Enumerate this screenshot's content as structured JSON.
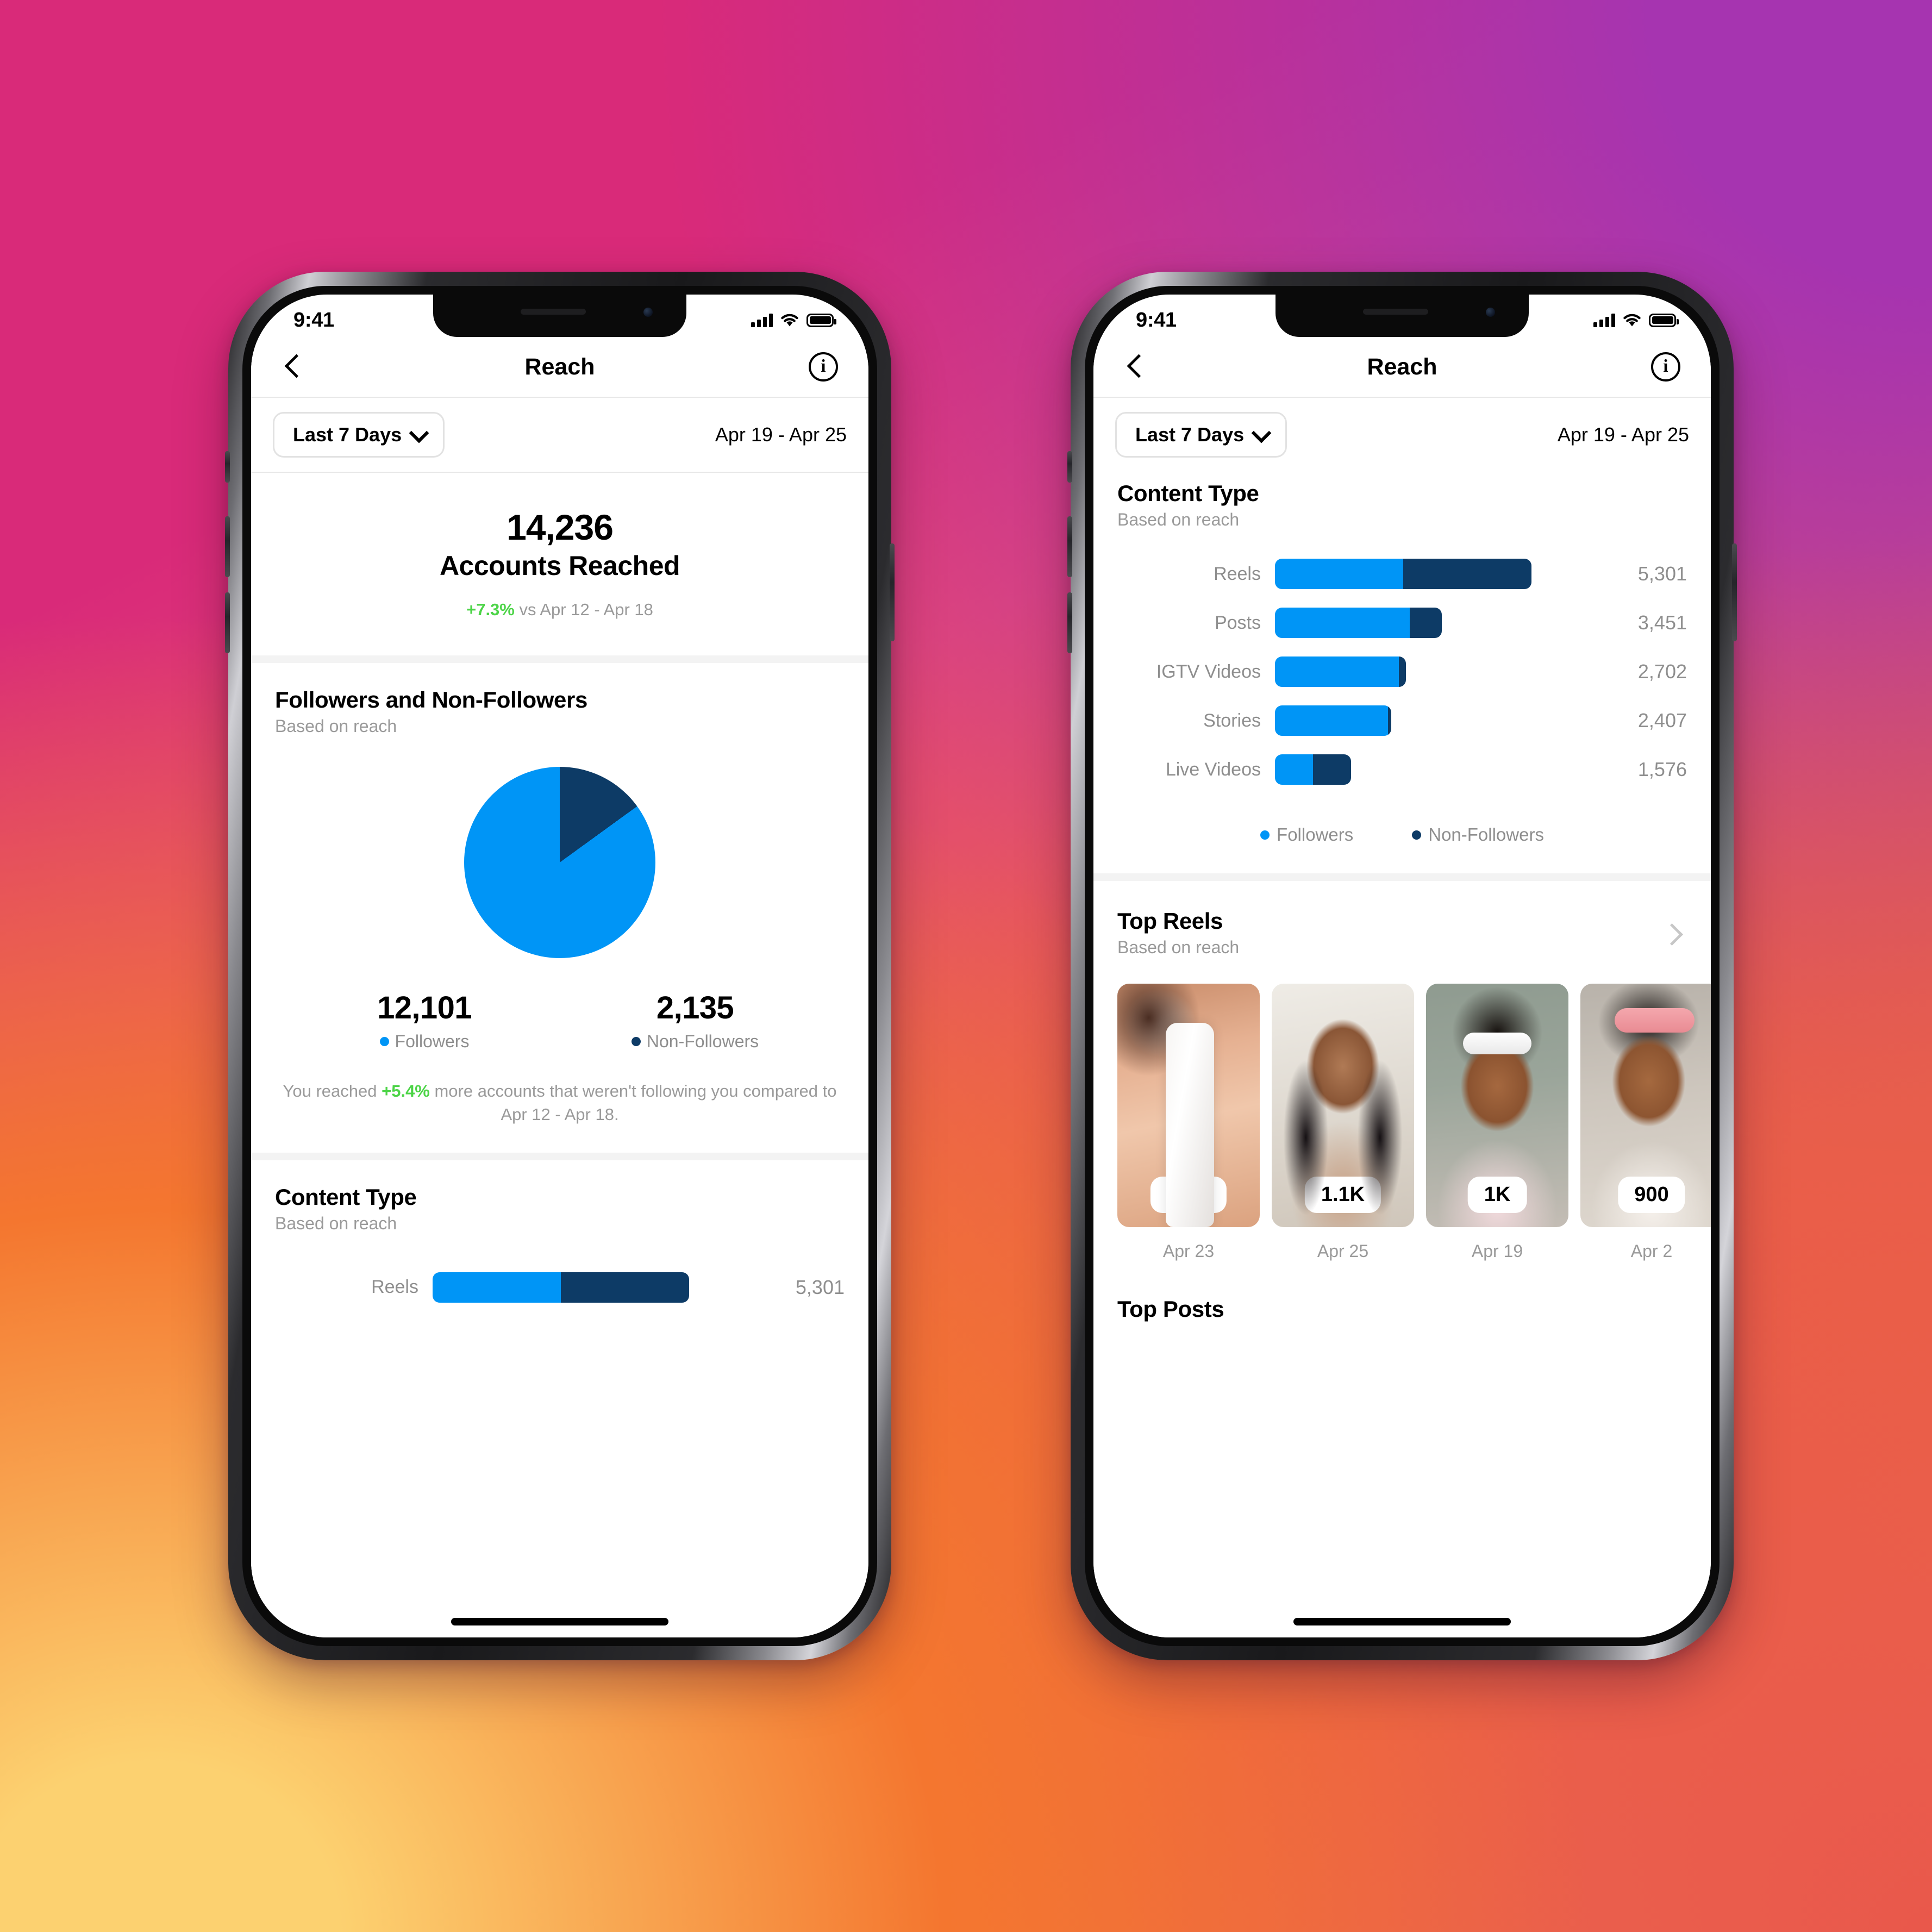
{
  "status_bar": {
    "time": "9:41",
    "icons": [
      "cellular-signal-icon",
      "wifi-icon",
      "battery-icon"
    ]
  },
  "nav": {
    "back_label": "Back",
    "title": "Reach",
    "info_label": "Info"
  },
  "filter": {
    "range_label": "Last 7 Days",
    "chevron": "chevron-down-icon",
    "date_range": "Apr 19 - Apr 25"
  },
  "hero": {
    "value": "14,236",
    "label": "Accounts Reached",
    "delta": "+7.3%",
    "delta_suffix": " vs Apr 12 - Apr 18"
  },
  "followers_section": {
    "title": "Followers and Non-Followers",
    "subtitle": "Based on reach",
    "followers_value": "12,101",
    "followers_label": "Followers",
    "nonfollowers_value": "2,135",
    "nonfollowers_label": "Non-Followers",
    "note_prefix": "You reached ",
    "note_delta": "+5.4%",
    "note_suffix": " more accounts that weren't following you compared to Apr 12 - Apr 18."
  },
  "content_type": {
    "title": "Content Type",
    "subtitle": "Based on reach",
    "legend": [
      {
        "label": "Followers",
        "color": "#0095F6"
      },
      {
        "label": "Non-Followers",
        "color": "#0D3B66"
      }
    ]
  },
  "top_reels": {
    "title": "Top Reels",
    "subtitle": "Based on reach",
    "chevron": "chevron-right-icon",
    "items": [
      {
        "badge": "2.3K",
        "date": "Apr 23",
        "alt": "reel-thumbnail-cleanser-bottle"
      },
      {
        "badge": "1.1K",
        "date": "Apr 25",
        "alt": "reel-thumbnail-portrait-long-hair"
      },
      {
        "badge": "1K",
        "date": "Apr 19",
        "alt": "reel-thumbnail-white-headband"
      },
      {
        "badge": "900",
        "date": "Apr 2",
        "alt": "reel-thumbnail-pink-headband"
      }
    ]
  },
  "top_posts": {
    "title": "Top Posts"
  },
  "colors": {
    "followers": "#0095F6",
    "non_followers": "#0D3B66",
    "positive": "#4CD447",
    "muted_text": "#9a9a9a",
    "bg_pink": "#D92A79",
    "bg_purple": "#A634B0",
    "bg_orange": "#EF6E3C",
    "bg_yellow": "#FCD170",
    "bg_red": "#E9584B"
  },
  "chart_data": [
    {
      "type": "pie",
      "title": "Followers and Non-Followers",
      "subtitle": "Based on reach",
      "labels": [
        "Followers",
        "Non-Followers"
      ],
      "values": [
        12101,
        2135
      ],
      "colors": [
        "#0095F6",
        "#0D3B66"
      ],
      "total": 14236,
      "start_angle_deg": 0,
      "slice_percentages": [
        85.0,
        15.0
      ],
      "legend": "below-chart"
    },
    {
      "type": "bar",
      "orientation": "horizontal",
      "stacked": true,
      "title": "Content Type",
      "subtitle": "Based on reach",
      "categories": [
        "Reels",
        "Posts",
        "IGTV Videos",
        "Stories",
        "Live Videos"
      ],
      "values": [
        5301,
        3451,
        2702,
        2407,
        1576
      ],
      "value_labels": [
        "5,301",
        "3,451",
        "2,702",
        "2,407",
        "1,576"
      ],
      "series": [
        {
          "name": "Followers",
          "color": "#0095F6",
          "values": [
            2650,
            2787,
            2560,
            2340,
            788
          ]
        },
        {
          "name": "Non-Followers",
          "color": "#0D3B66",
          "values": [
            2651,
            664,
            142,
            67,
            788
          ]
        }
      ],
      "followers_share_pct": [
        50,
        80.7,
        94.7,
        97.2,
        50
      ],
      "xlim": [
        0,
        5301
      ],
      "grid": false,
      "legend": "bottom-center",
      "legend_entries": [
        "Followers",
        "Non-Followers"
      ]
    }
  ]
}
